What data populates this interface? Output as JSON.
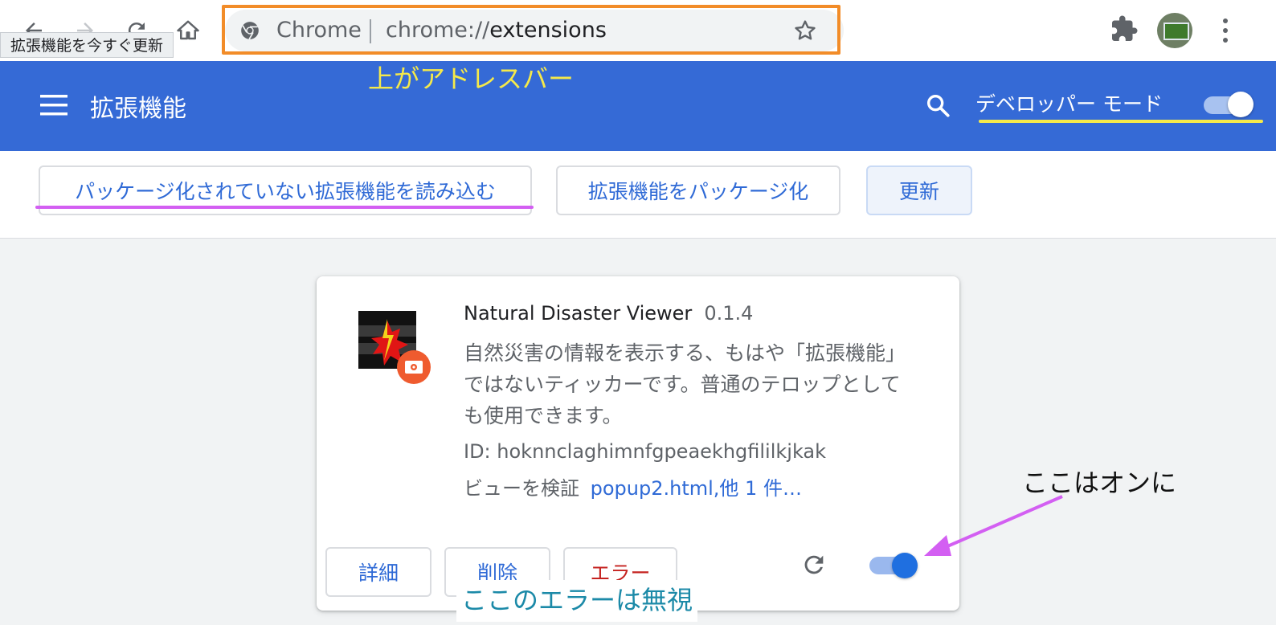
{
  "browser": {
    "omnibox_label": "Chrome",
    "url_prefix": "chrome://",
    "url_path": "extensions",
    "tooltip": "拡張機能を今すぐ更新"
  },
  "header": {
    "title": "拡張機能",
    "dev_mode_label": "デベロッパー モード",
    "dev_mode_on": true
  },
  "actions": {
    "load_unpacked": "パッケージ化されていない拡張機能を読み込む",
    "pack": "拡張機能をパッケージ化",
    "update": "更新"
  },
  "extension": {
    "name": "Natural Disaster Viewer",
    "version": "0.1.4",
    "description": "自然災害の情報を表示する、もはや「拡張機能」ではないティッカーです。普通のテロップとしても使用できます。",
    "id_line": "ID: hoknnclaghimnfgpeaekhgfililkjkak",
    "inspect_label": "ビューを検証",
    "inspect_link": "popup2.html,他 1 件…",
    "details_label": "詳細",
    "remove_label": "削除",
    "errors_label": "エラー",
    "enabled": true
  },
  "annotations": {
    "address_bar": "上がアドレスバー",
    "turn_on": "ここはオンに",
    "ignore_error": "ここのエラーは無視"
  },
  "colors": {
    "header_bg": "#356ad6",
    "accent": "#2f6ad6",
    "error": "#c5221f",
    "annot_orange": "#f28c28",
    "annot_purple": "#d35ff2",
    "annot_yellow": "#f5e94a",
    "annot_teal": "#1c8aa8"
  }
}
